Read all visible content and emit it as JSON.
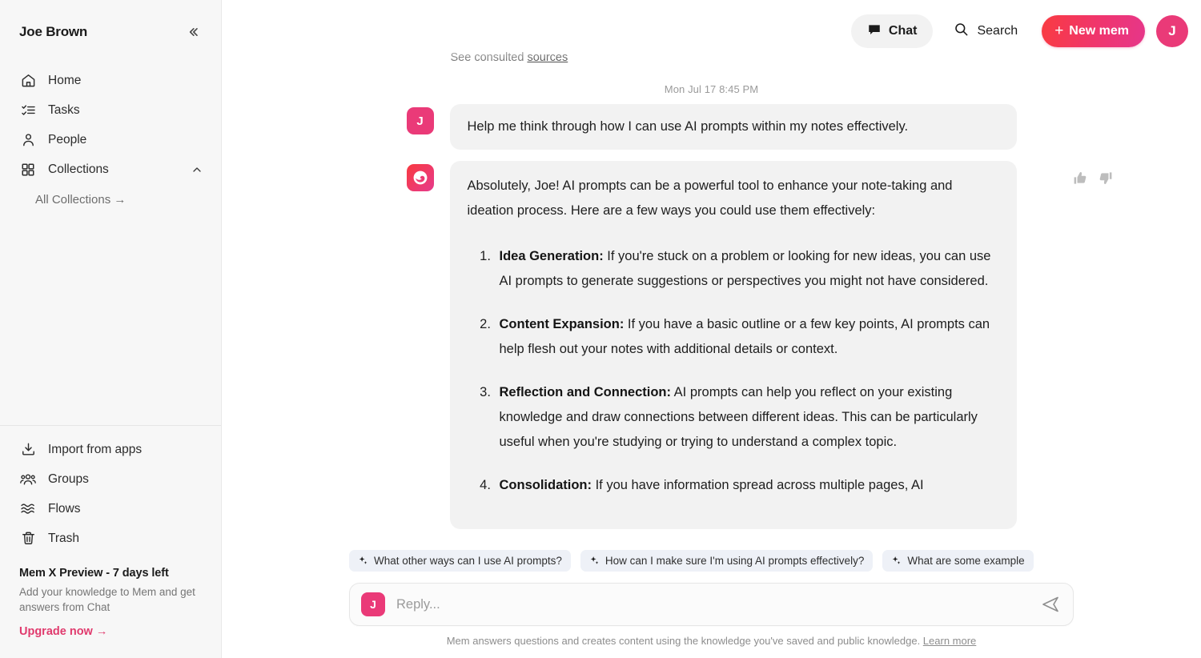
{
  "sidebar": {
    "user_name": "Joe Brown",
    "collapse_icon": "chevrons-left-icon",
    "nav": [
      {
        "label": "Home",
        "icon": "home-icon"
      },
      {
        "label": "Tasks",
        "icon": "checklist-icon"
      },
      {
        "label": "People",
        "icon": "person-icon"
      },
      {
        "label": "Collections",
        "icon": "grid-icon",
        "chevron": "chevron-up-icon"
      }
    ],
    "sub_item": {
      "label": "All Collections →"
    },
    "bottom_nav": [
      {
        "label": "Import from apps",
        "icon": "import-icon"
      },
      {
        "label": "Groups",
        "icon": "groups-icon"
      },
      {
        "label": "Flows",
        "icon": "flows-icon"
      },
      {
        "label": "Trash",
        "icon": "trash-icon"
      }
    ],
    "promo": {
      "title": "Mem X Preview - 7 days left",
      "body": "Add your knowledge to Mem and get answers from Chat",
      "link": "Upgrade now →"
    }
  },
  "topbar": {
    "chat_label": "Chat",
    "chat_icon": "speech-bubble-icon",
    "search_label": "Search",
    "search_icon": "search-icon",
    "new_mem_label": "New mem",
    "new_mem_plus": "+",
    "avatar_initial": "J"
  },
  "conversation": {
    "sources_prefix": "See consulted ",
    "sources_link": "sources",
    "timestamp": "Mon Jul 17 8:45 PM",
    "user_message": {
      "avatar_initial": "J",
      "text": "Help me think through how I can use AI prompts within my notes effectively."
    },
    "assistant_message": {
      "avatar_icon": "mem-logo-icon",
      "intro": "Absolutely, Joe! AI prompts can be a powerful tool to enhance your note-taking and ideation process. Here are a few ways you could use them effectively:",
      "items": [
        {
          "title": "Idea Generation:",
          "body": " If you're stuck on a problem or looking for new ideas, you can use AI prompts to generate suggestions or perspectives you might not have considered."
        },
        {
          "title": "Content Expansion:",
          "body": " If you have a basic outline or a few key points, AI prompts can help flesh out your notes with additional details or context."
        },
        {
          "title": "Reflection and Connection:",
          "body": " AI prompts can help you reflect on your existing knowledge and draw connections between different ideas. This can be particularly useful when you're studying or trying to understand a complex topic."
        },
        {
          "title": "Consolidation:",
          "body": " If you have information spread across multiple pages, AI"
        }
      ],
      "thumbs_up_icon": "thumbs-up-icon",
      "thumbs_down_icon": "thumbs-down-icon"
    }
  },
  "composer": {
    "suggestions": [
      "What other ways can I use AI prompts?",
      "How can I make sure I'm using AI prompts effectively?",
      "What are some example"
    ],
    "suggestion_icon": "sparkle-icon",
    "avatar_initial": "J",
    "input_value": "",
    "input_placeholder": "Reply...",
    "send_icon": "send-icon",
    "disclaimer_text": "Mem answers questions and creates content using the knowledge you've saved and public knowledge. ",
    "disclaimer_link": "Learn more"
  },
  "colors": {
    "brand_pink": "#ea3a78",
    "brand_red": "#f93b41",
    "sidebar_bg": "#f7f7f7",
    "bubble_bg": "#f2f2f2",
    "chip_bg": "#eef1f7"
  }
}
